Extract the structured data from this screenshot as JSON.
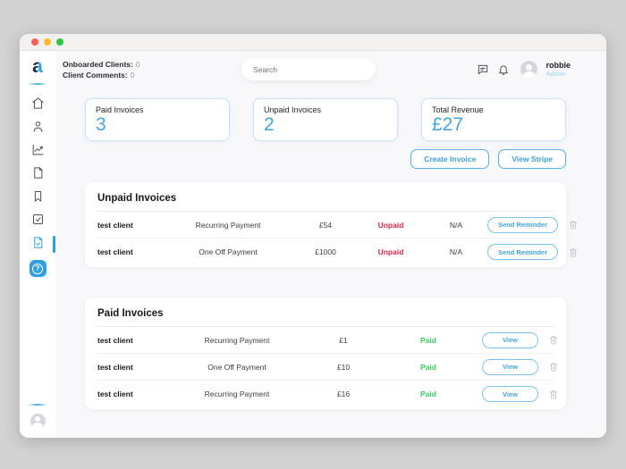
{
  "header": {
    "onboarded_label": "Onboarded Clients:",
    "onboarded_count": "0",
    "comments_label": "Client Comments:",
    "comments_count": "0",
    "search_placeholder": "Search",
    "user_name": "robbie",
    "user_role": "Admin"
  },
  "sidebar": {
    "logo_letter": "a",
    "icons": [
      "home-icon",
      "clients-icon",
      "analytics-icon",
      "document-icon",
      "bookmark-icon",
      "tasks-icon",
      "invoices-icon",
      "help-icon"
    ],
    "active_item": "invoices",
    "help_glyph": "?"
  },
  "stats": {
    "paid": {
      "label": "Paid Invoices",
      "value": "3"
    },
    "unpaid": {
      "label": "Unpaid Invoices",
      "value": "2"
    },
    "revenue": {
      "label": "Total Revenue",
      "value": "£27"
    }
  },
  "actions": {
    "create_invoice": "Create Invoice",
    "view_stripe": "View Stripe"
  },
  "unpaid_section": {
    "title": "Unpaid Invoices",
    "rows": [
      {
        "client": "test client",
        "type": "Recurring Payment",
        "amount": "£54",
        "status": "Unpaid",
        "extra": "N/A",
        "action": "Send Reminder"
      },
      {
        "client": "test client",
        "type": "One Off Payment",
        "amount": "£1000",
        "status": "Unpaid",
        "extra": "N/A",
        "action": "Send Reminder"
      }
    ]
  },
  "paid_section": {
    "title": "Paid Invoices",
    "rows": [
      {
        "client": "test client",
        "type": "Recurring Payment",
        "amount": "£1",
        "status": "Paid",
        "action": "View"
      },
      {
        "client": "test client",
        "type": "One Off Payment",
        "amount": "£10",
        "status": "Paid",
        "action": "View"
      },
      {
        "client": "test client",
        "type": "Recurring Payment",
        "amount": "£16",
        "status": "Paid",
        "action": "View"
      }
    ]
  },
  "colors": {
    "accent_blue": "#2f9fe0",
    "value_blue": "#47a4da",
    "unpaid_red": "#d6294a",
    "paid_green": "#3fca60",
    "admin_cyan": "#8fd4ea"
  }
}
